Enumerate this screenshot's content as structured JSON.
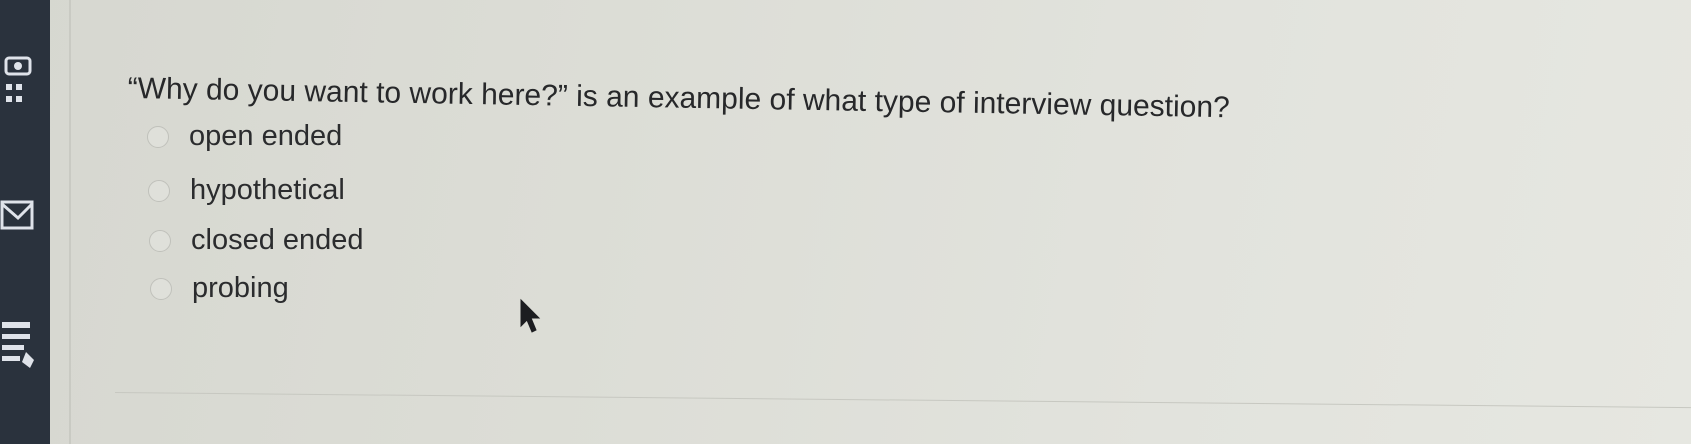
{
  "question": {
    "text": "“Why do you want to work here?” is an example of what type of interview question?"
  },
  "options": [
    {
      "label": "open ended",
      "selected": false
    },
    {
      "label": "hypothetical",
      "selected": false
    },
    {
      "label": "closed ended",
      "selected": false
    },
    {
      "label": "probing",
      "selected": false
    }
  ],
  "sidebar": {
    "icons": [
      "settings-icon",
      "grid-icon",
      "envelope-icon",
      "notes-icon"
    ]
  },
  "colors": {
    "page_background": "#dcddd6",
    "sidebar_background": "#2a323d",
    "text": "#27282a",
    "radio_border": "#c0c1bb"
  }
}
